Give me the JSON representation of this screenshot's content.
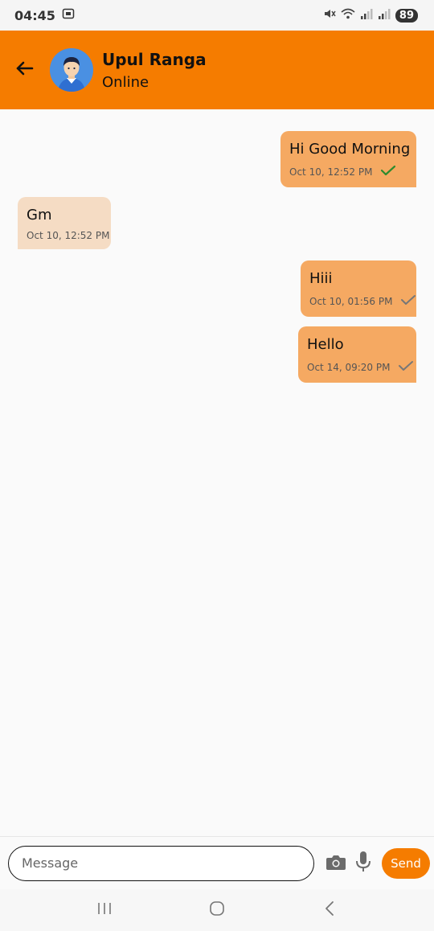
{
  "status_bar": {
    "time": "04:45",
    "battery": "89"
  },
  "header": {
    "contact_name": "Upul Ranga",
    "contact_status": "Online"
  },
  "messages": [
    {
      "direction": "out",
      "text": "Hi Good Morning",
      "time": "Oct 10, 12:52 PM",
      "status": "read"
    },
    {
      "direction": "in",
      "text": "Gm",
      "time": "Oct 10, 12:52 PM"
    },
    {
      "direction": "out",
      "text": "Hiii",
      "time": "Oct 10, 01:56 PM",
      "status": "sent"
    },
    {
      "direction": "out",
      "text": "Hello",
      "time": "Oct 14, 09:20 PM",
      "status": "sent"
    }
  ],
  "composer": {
    "placeholder": "Message",
    "value": "",
    "send_label": "Send"
  },
  "colors": {
    "accent": "#f57c00",
    "outgoing_bubble": "#f5a962",
    "incoming_bubble": "#f5dcc4",
    "read_tick": "#2e8b2e",
    "sent_tick": "#777777"
  },
  "icons": {
    "back": "arrow-left-icon",
    "camera": "camera-icon",
    "mic": "microphone-icon"
  }
}
